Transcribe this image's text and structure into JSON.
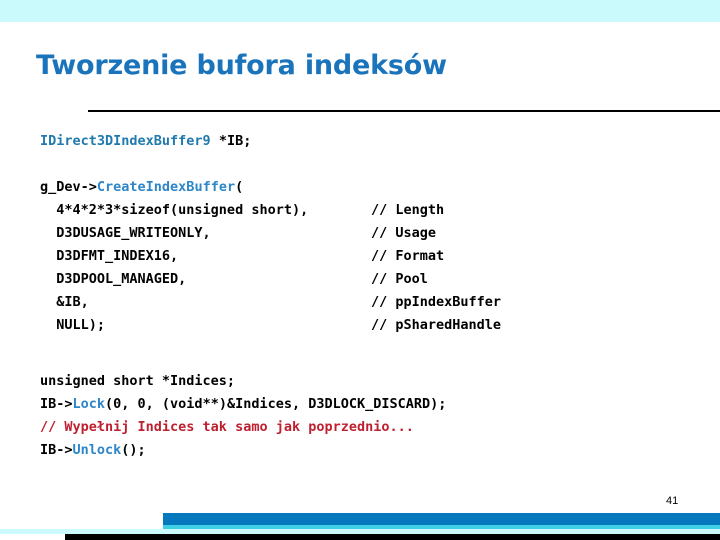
{
  "slide": {
    "title": "Tworzenie bufora indeksów",
    "page_number": "41",
    "colors": {
      "title_blue": "#1A74BC",
      "band_cyan": "#CAFAFC",
      "footer_blue": "#0578BE",
      "footer_cyan": "#3FD0E8",
      "code_type_blue": "#1F7AAE",
      "code_call_blue": "#2E86C8",
      "comment_red": "#BE2030"
    }
  },
  "code": {
    "line1_decl_type": "IDirect3DIndexBuffer9",
    "line1_decl_var": " *IB;",
    "line2_obj": "g_Dev->",
    "line2_method": "CreateIndexBuffer",
    "line2_paren": "(",
    "params": [
      {
        "code": "  4*4*2*3*sizeof(unsigned short),",
        "comment": "// Length"
      },
      {
        "code": "  D3DUSAGE_WRITEONLY,",
        "comment": "// Usage"
      },
      {
        "code": "  D3DFMT_INDEX16,",
        "comment": "// Format"
      },
      {
        "code": "  D3DPOOL_MANAGED,",
        "comment": "// Pool"
      },
      {
        "code": "  &IB,",
        "comment": "// ppIndexBuffer"
      },
      {
        "code": "  NULL);",
        "comment": "// pSharedHandle"
      }
    ],
    "line_indices_decl": "unsigned short *Indices;",
    "lock_obj": "IB->",
    "lock_method": "Lock",
    "lock_args": "(0, 0, (void**)&Indices, D3DLOCK_DISCARD);",
    "comment_polish": "// Wypełnij Indices tak samo jak poprzednio...",
    "unlock_obj": "IB->",
    "unlock_method": "Unlock",
    "unlock_args": "();"
  }
}
